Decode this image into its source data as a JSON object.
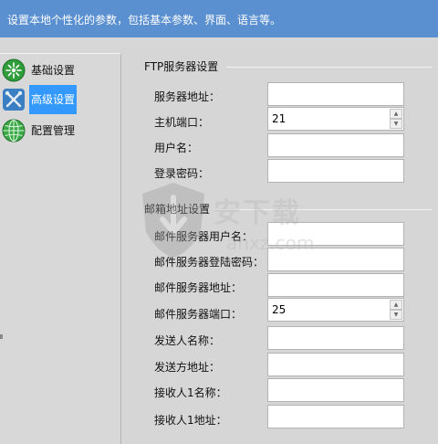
{
  "header": {
    "description": "设置本地个性化的参数，包括基本参数、界面、语言等。"
  },
  "sidebar": {
    "items": [
      {
        "label": "基础设置",
        "icon": "basic-settings-icon",
        "active": false
      },
      {
        "label": "高级设置",
        "icon": "tools-icon",
        "active": true
      },
      {
        "label": "配置管理",
        "icon": "globe-icon",
        "active": false
      }
    ]
  },
  "ftp": {
    "title": "FTP服务器设置",
    "fields": [
      {
        "label": "服务器地址：",
        "value": ""
      },
      {
        "label": "主机端口：",
        "value": "21"
      },
      {
        "label": "用户名：",
        "value": ""
      },
      {
        "label": "登录密码：",
        "value": ""
      }
    ]
  },
  "mail": {
    "title": "邮箱地址设置",
    "fields": [
      {
        "label": "邮件服务器用户名：",
        "value": ""
      },
      {
        "label": "邮件服务器登陆密码：",
        "value": ""
      },
      {
        "label": "邮件服务器地址：",
        "value": ""
      },
      {
        "label": "邮件服务器端口：",
        "value": "25"
      },
      {
        "label": "发送人名称：",
        "value": ""
      },
      {
        "label": "发送方地址：",
        "value": ""
      },
      {
        "label": "接收人1名称：",
        "value": ""
      },
      {
        "label": "接收人1地址：",
        "value": ""
      }
    ]
  },
  "watermark": {
    "text": "安下载",
    "domain": "anxz.com"
  },
  "colors": {
    "header_bg": "#5a8fd0",
    "active_bg": "#3399ff",
    "panel_bg": "#d6d6d6"
  }
}
